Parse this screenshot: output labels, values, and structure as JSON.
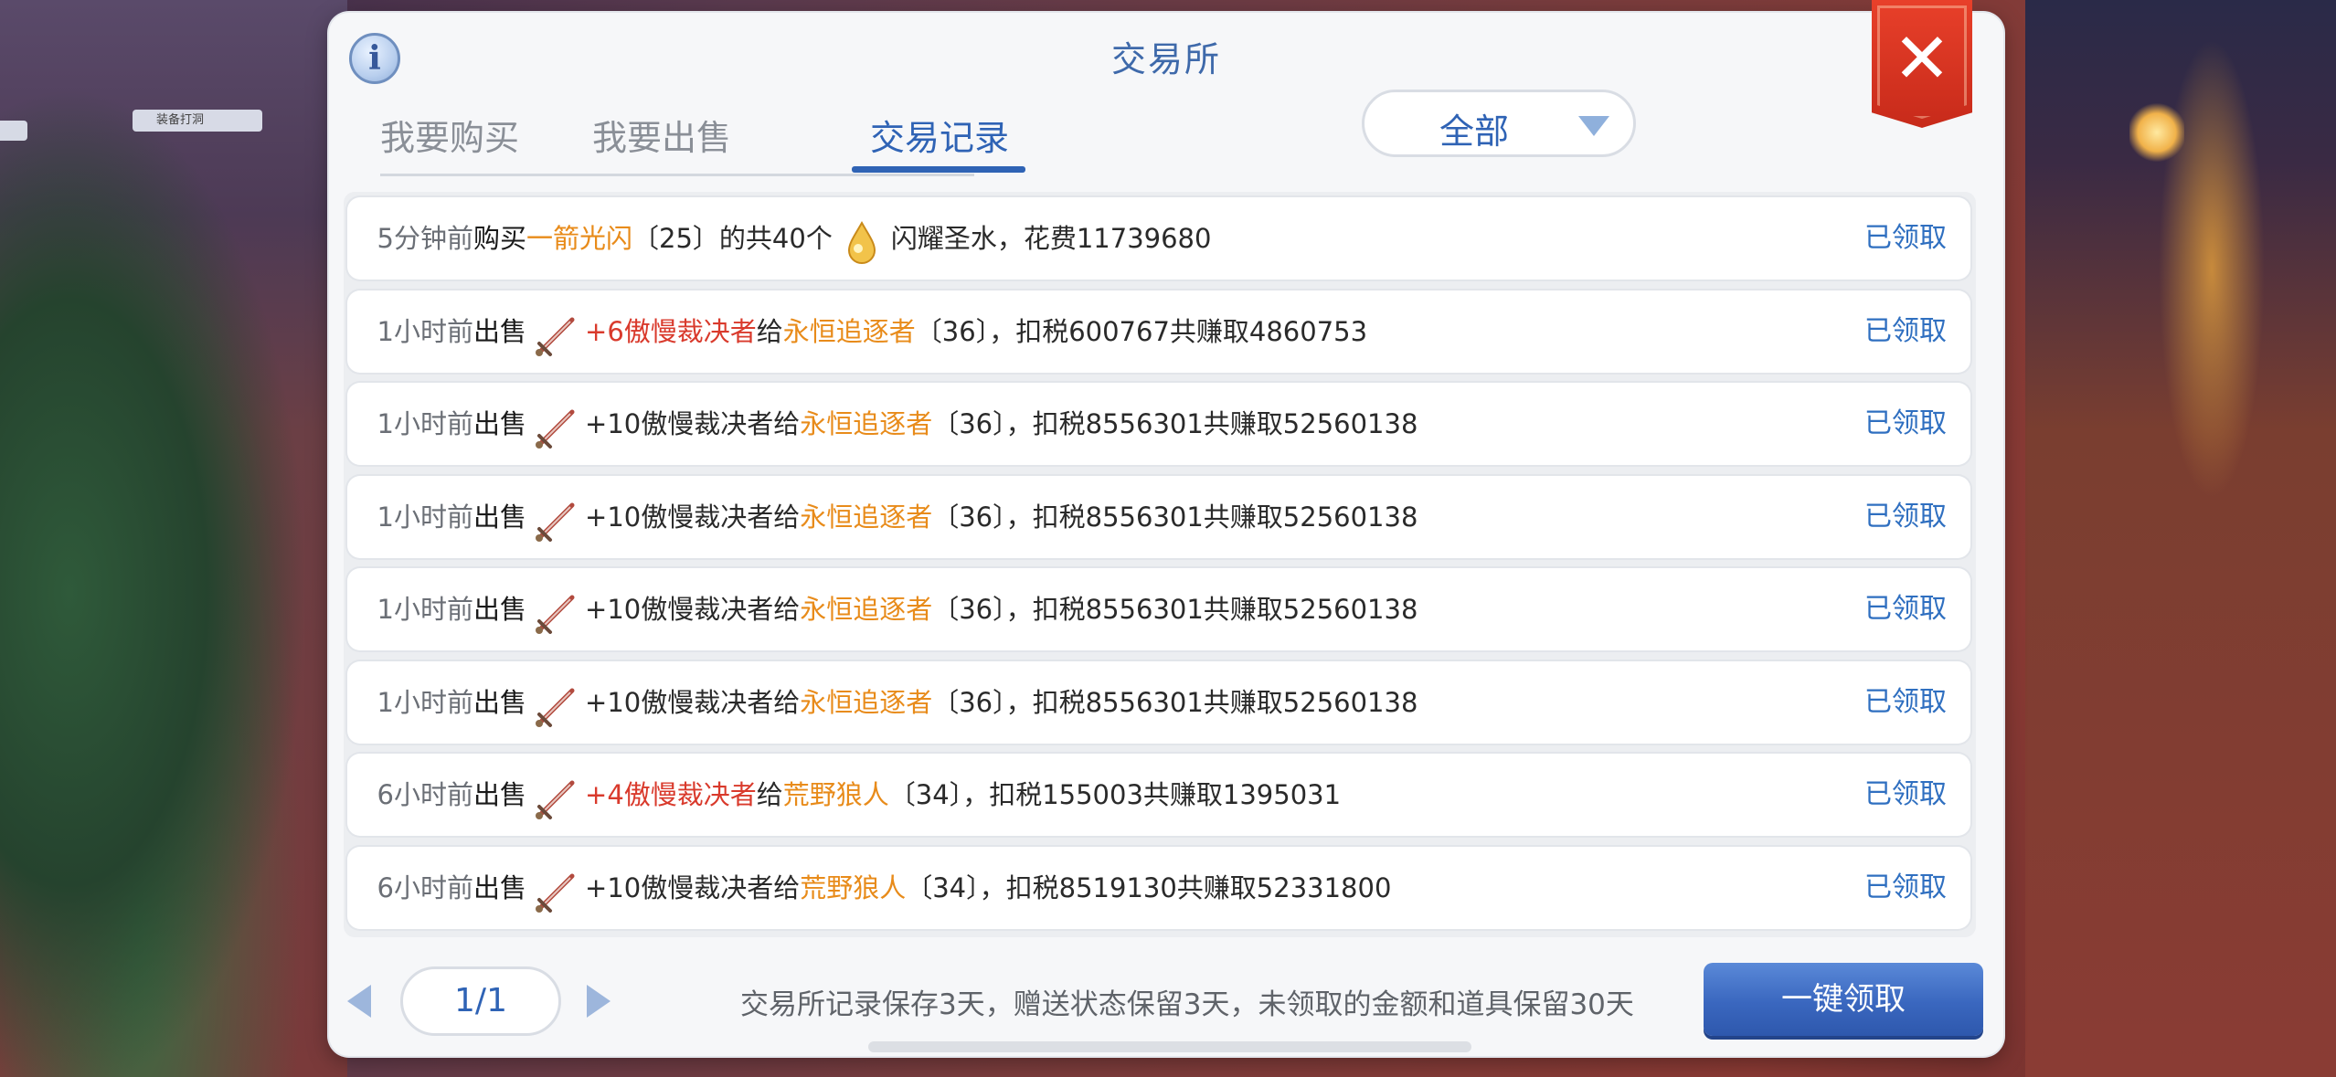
{
  "panel": {
    "title": "交易所",
    "info_icon": "info-icon",
    "close_icon": "close-icon"
  },
  "tabs": [
    {
      "label": "我要购买",
      "active": false
    },
    {
      "label": "我要出售",
      "active": false
    },
    {
      "label": "交易记录",
      "active": true
    }
  ],
  "filter": {
    "value": "全部",
    "icon": "chevron-down-icon"
  },
  "npc_tag": "装备打洞",
  "records": [
    {
      "time": "5分钟前",
      "verb": "购买",
      "icon": "holy-water-icon",
      "parts": [
        {
          "text": "一箭光闪",
          "color": "orange"
        },
        {
          "text": "〔25〕的共40个",
          "color": "default"
        },
        {
          "text": "ICON",
          "color": "icon"
        },
        {
          "text": "闪耀圣水，花费11739680",
          "color": "default"
        }
      ],
      "status": "已领取"
    },
    {
      "time": "1小时前",
      "verb": "出售",
      "icon": "sword-icon",
      "parts": [
        {
          "text": "+6傲慢裁决者",
          "color": "red"
        },
        {
          "text": "给",
          "color": "default"
        },
        {
          "text": "永恒追逐者",
          "color": "orange"
        },
        {
          "text": "〔36〕，扣税600767共赚取4860753",
          "color": "default"
        }
      ],
      "status": "已领取"
    },
    {
      "time": "1小时前",
      "verb": "出售",
      "icon": "sword-icon",
      "parts": [
        {
          "text": "+10傲慢裁决者给",
          "color": "default"
        },
        {
          "text": "永恒追逐者",
          "color": "orange"
        },
        {
          "text": "〔36〕，扣税8556301共赚取52560138",
          "color": "default"
        }
      ],
      "status": "已领取"
    },
    {
      "time": "1小时前",
      "verb": "出售",
      "icon": "sword-icon",
      "parts": [
        {
          "text": "+10傲慢裁决者给",
          "color": "default"
        },
        {
          "text": "永恒追逐者",
          "color": "orange"
        },
        {
          "text": "〔36〕，扣税8556301共赚取52560138",
          "color": "default"
        }
      ],
      "status": "已领取"
    },
    {
      "time": "1小时前",
      "verb": "出售",
      "icon": "sword-icon",
      "parts": [
        {
          "text": "+10傲慢裁决者给",
          "color": "default"
        },
        {
          "text": "永恒追逐者",
          "color": "orange"
        },
        {
          "text": "〔36〕，扣税8556301共赚取52560138",
          "color": "default"
        }
      ],
      "status": "已领取"
    },
    {
      "time": "1小时前",
      "verb": "出售",
      "icon": "sword-icon",
      "parts": [
        {
          "text": "+10傲慢裁决者给",
          "color": "default"
        },
        {
          "text": "永恒追逐者",
          "color": "orange"
        },
        {
          "text": "〔36〕，扣税8556301共赚取52560138",
          "color": "default"
        }
      ],
      "status": "已领取"
    },
    {
      "time": "6小时前",
      "verb": "出售",
      "icon": "sword-icon",
      "parts": [
        {
          "text": "+4傲慢裁决者",
          "color": "red"
        },
        {
          "text": "给",
          "color": "default"
        },
        {
          "text": "荒野狼人",
          "color": "orange"
        },
        {
          "text": "〔34〕，扣税155003共赚取1395031",
          "color": "default"
        }
      ],
      "status": "已领取"
    },
    {
      "time": "6小时前",
      "verb": "出售",
      "icon": "sword-icon",
      "parts": [
        {
          "text": "+10傲慢裁决者给",
          "color": "default"
        },
        {
          "text": "荒野狼人",
          "color": "orange"
        },
        {
          "text": "〔34〕，扣税8519130共赚取52331800",
          "color": "default"
        }
      ],
      "status": "已领取"
    }
  ],
  "footer": {
    "page": "1/1",
    "note": "交易所记录保存3天，赠送状态保留3天，未领取的金额和道具保留30天",
    "claim_all": "一键领取",
    "prev_icon": "arrow-left-icon",
    "next_icon": "arrow-right-icon"
  },
  "colors": {
    "accent_blue": "#2f63b5",
    "orange": "#e88b1a",
    "red": "#d93a2c",
    "close_red": "#d9331f"
  }
}
